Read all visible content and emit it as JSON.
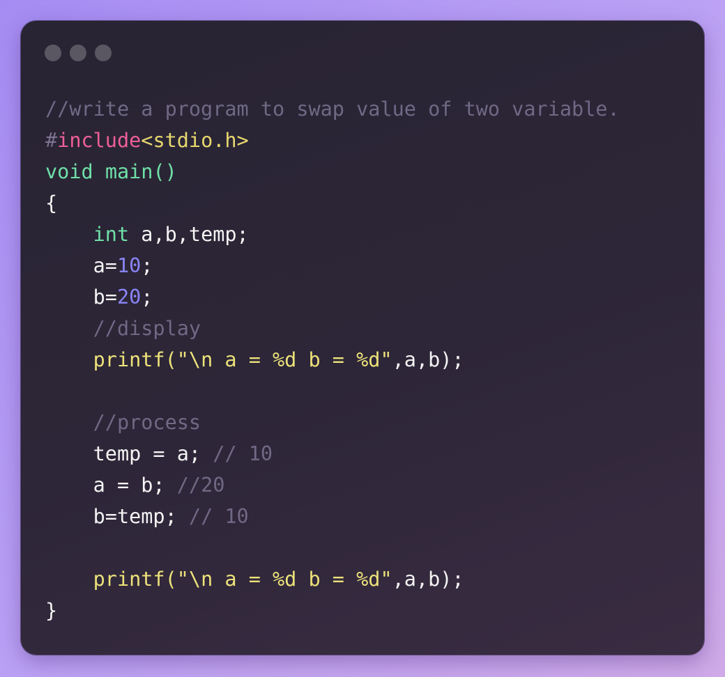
{
  "window": {
    "controls": [
      "close",
      "minimize",
      "maximize"
    ]
  },
  "code_lines": [
    [
      {
        "t": "//write a program to swap value of two variable.",
        "k": "comment"
      }
    ],
    [
      {
        "t": "#",
        "k": "hash"
      },
      {
        "t": "include",
        "k": "directive"
      },
      {
        "t": "<stdio.h>",
        "k": "header"
      }
    ],
    [
      {
        "t": "void",
        "k": "type"
      },
      {
        "t": " ",
        "k": "plain"
      },
      {
        "t": "main()",
        "k": "funcdef"
      }
    ],
    [
      {
        "t": "{",
        "k": "plain"
      }
    ],
    [
      {
        "t": "    ",
        "k": "plain"
      },
      {
        "t": "int",
        "k": "type"
      },
      {
        "t": " a,b,temp;",
        "k": "plain"
      }
    ],
    [
      {
        "t": "    a=",
        "k": "plain"
      },
      {
        "t": "10",
        "k": "number"
      },
      {
        "t": ";",
        "k": "plain"
      }
    ],
    [
      {
        "t": "    b=",
        "k": "plain"
      },
      {
        "t": "20",
        "k": "number"
      },
      {
        "t": ";",
        "k": "plain"
      }
    ],
    [
      {
        "t": "    ",
        "k": "plain"
      },
      {
        "t": "//display",
        "k": "comment"
      }
    ],
    [
      {
        "t": "    ",
        "k": "plain"
      },
      {
        "t": "printf(\"\\n a = %d b = %d\"",
        "k": "func"
      },
      {
        "t": ",a,b);",
        "k": "plain"
      }
    ],
    [],
    [
      {
        "t": "    ",
        "k": "plain"
      },
      {
        "t": "//process",
        "k": "comment"
      }
    ],
    [
      {
        "t": "    temp = a; ",
        "k": "plain"
      },
      {
        "t": "// 10",
        "k": "comment"
      }
    ],
    [
      {
        "t": "    a = b; ",
        "k": "plain"
      },
      {
        "t": "//20",
        "k": "comment"
      }
    ],
    [
      {
        "t": "    b=temp; ",
        "k": "plain"
      },
      {
        "t": "// 10",
        "k": "comment"
      }
    ],
    [],
    [
      {
        "t": "    ",
        "k": "plain"
      },
      {
        "t": "printf(\"\\n a = %d b = %d\"",
        "k": "func"
      },
      {
        "t": ",a,b);",
        "k": "plain"
      }
    ],
    [
      {
        "t": "}",
        "k": "plain"
      }
    ]
  ]
}
